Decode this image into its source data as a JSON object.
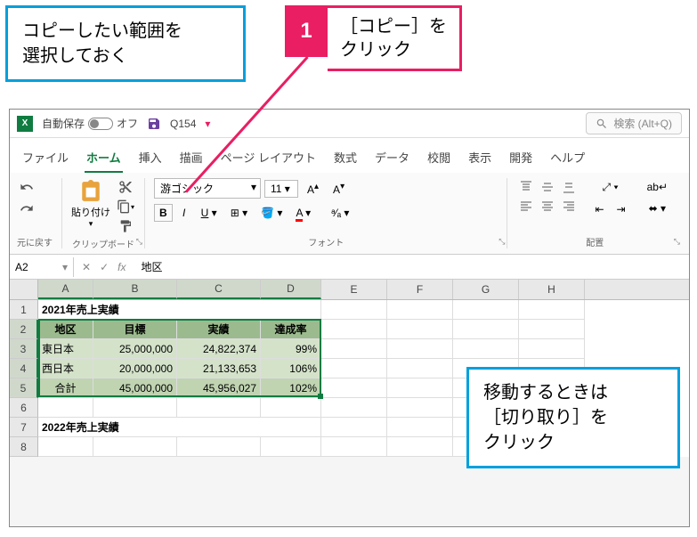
{
  "callouts": {
    "left": "コピーしたい範囲を\n選択しておく",
    "step1_num": "1",
    "step1_text": "［コピー］を\nクリック",
    "right": "移動するときは\n［切り取り］を\nクリック"
  },
  "titlebar": {
    "autosave_label": "自動保存",
    "autosave_state": "オフ",
    "cell_ref": "Q154",
    "search_placeholder": "検索 (Alt+Q)"
  },
  "tabs": [
    "ファイル",
    "ホーム",
    "挿入",
    "描画",
    "ページ レイアウト",
    "数式",
    "データ",
    "校閲",
    "表示",
    "開発",
    "ヘルプ"
  ],
  "ribbon": {
    "undo_group": "元に戻す",
    "clipboard_group": "クリップボード",
    "paste_label": "貼り付け",
    "font_group": "フォント",
    "font_name": "游ゴシック",
    "font_size": "11",
    "align_group": "配置"
  },
  "formula": {
    "name_box": "A2",
    "value": "地区"
  },
  "columns": [
    "A",
    "B",
    "C",
    "D",
    "E",
    "F",
    "G",
    "H"
  ],
  "sheet": {
    "title_2021": "2021年売上実績",
    "title_2022": "2022年売上実績",
    "headers": {
      "region": "地区",
      "target": "目標",
      "actual": "実績",
      "rate": "達成率"
    },
    "rows": [
      {
        "region": "東日本",
        "target": "25,000,000",
        "actual": "24,822,374",
        "rate": "99%"
      },
      {
        "region": "西日本",
        "target": "20,000,000",
        "actual": "21,133,653",
        "rate": "106%"
      },
      {
        "region": "合計",
        "target": "45,000,000",
        "actual": "45,956,027",
        "rate": "102%"
      }
    ]
  }
}
